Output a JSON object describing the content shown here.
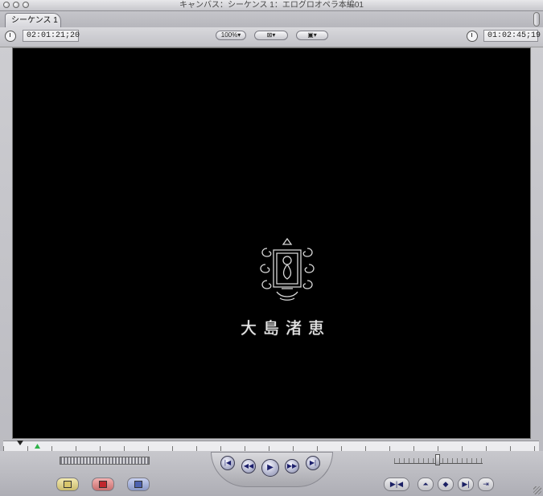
{
  "window": {
    "title": "キャンバス：シーケンス 1：エログロオペラ本編01"
  },
  "tabs": [
    {
      "label": "シーケンス 1"
    }
  ],
  "toolbar": {
    "left_timecode": "02:01:21;20",
    "right_timecode": "01:02:45;19",
    "zoom_label": "100%",
    "zoom_arrow": "▾",
    "view_arrow": "▾",
    "overlay_arrow": "▾"
  },
  "canvas": {
    "background_color": "#000000",
    "overlay_text": "大島渚恵"
  },
  "transport": {
    "prev_edit": "|◀",
    "step_back": "◀◀",
    "play": "▶",
    "step_forward": "▶▶",
    "next_edit": "▶|"
  },
  "icons": {
    "clock_left": "clock-icon",
    "clock_right": "clock-icon",
    "marker": "marker-icon",
    "overlay": "overlay-icon",
    "insert": "insert-icon",
    "overwrite": "overwrite-icon",
    "replace": "replace-icon",
    "match_frame": "match-frame-icon",
    "mark_in": "mark-in-icon",
    "mark_out": "mark-out-icon",
    "add_marker": "add-marker-icon",
    "add_keyframe": "add-keyframe-icon"
  }
}
